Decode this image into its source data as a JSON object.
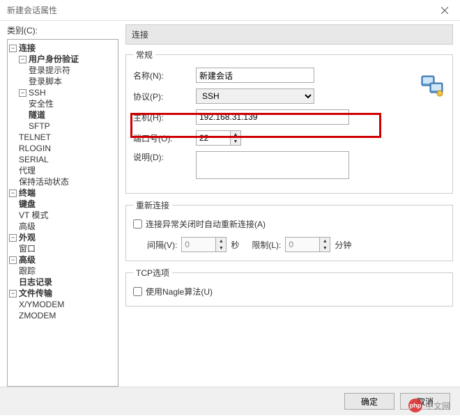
{
  "window": {
    "title": "新建会话属性",
    "close_icon": "close"
  },
  "category_label": "类别(C):",
  "tree": {
    "connection": "连接",
    "user_auth": "用户身份验证",
    "login_prompt": "登录提示符",
    "login_script": "登录脚本",
    "ssh": "SSH",
    "security": "安全性",
    "tunnel": "隧道",
    "sftp": "SFTP",
    "telnet": "TELNET",
    "rlogin": "RLOGIN",
    "serial": "SERIAL",
    "proxy": "代理",
    "keepalive": "保持活动状态",
    "terminal": "终端",
    "keyboard": "键盘",
    "vt_mode": "VT 模式",
    "advanced1": "高级",
    "appearance": "外观",
    "window": "窗口",
    "advanced2": "高级",
    "trace": "跟踪",
    "log_record": "日志记录",
    "file_transfer": "文件传输",
    "xymodem": "X/YMODEM",
    "zmodem": "ZMODEM"
  },
  "panel": {
    "header": "连接"
  },
  "general": {
    "legend": "常规",
    "name_label": "名称(N):",
    "name_value": "新建会话",
    "protocol_label": "协议(P):",
    "protocol_value": "SSH",
    "host_label": "主机(H):",
    "host_value": "192.168.31.139",
    "port_label": "端口号(O):",
    "port_value": "22",
    "desc_label": "说明(D):",
    "desc_value": ""
  },
  "reconnect": {
    "legend": "重新连接",
    "checkbox_label": "连接异常关闭时自动重新连接(A)",
    "interval_label": "间隔(V):",
    "interval_value": "0",
    "interval_unit": "秒",
    "limit_label": "限制(L):",
    "limit_value": "0",
    "limit_unit": "分钟"
  },
  "tcp": {
    "legend": "TCP选项",
    "nagle_label": "使用Nagle算法(U)"
  },
  "buttons": {
    "ok": "确定",
    "cancel": "取消"
  },
  "watermark": {
    "badge": "php",
    "text": "中文网"
  },
  "toggles": {
    "minus": "−",
    "plus": "+"
  }
}
